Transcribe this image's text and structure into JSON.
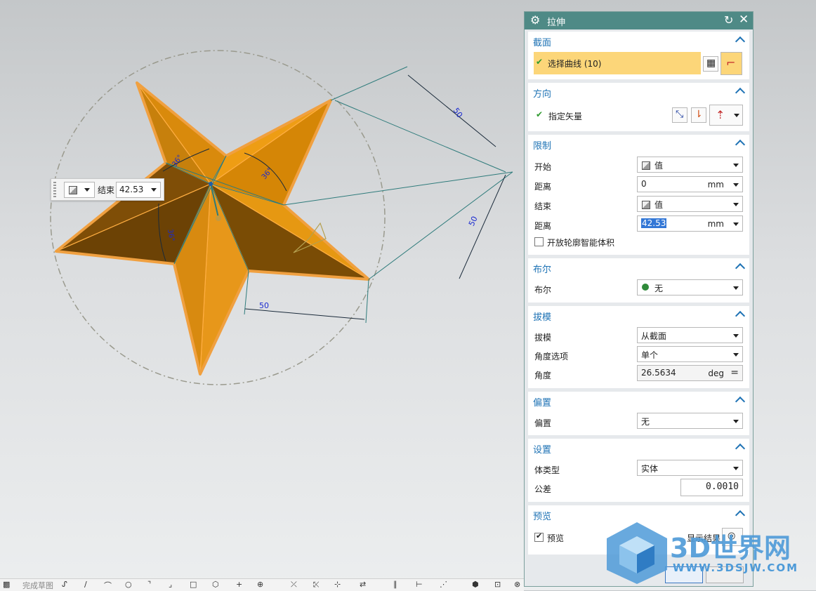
{
  "dialog": {
    "title": "拉伸",
    "sections": {
      "section": {
        "header": "截面",
        "select_curve": "选择曲线 (10)"
      },
      "direction": {
        "header": "方向",
        "vector": "指定矢量"
      },
      "limits": {
        "header": "限制",
        "start_label": "开始",
        "start_value": "值",
        "start_dist_label": "距离",
        "start_dist_value": "0",
        "start_dist_unit": "mm",
        "end_label": "结束",
        "end_value": "值",
        "end_dist_label": "距离",
        "end_dist_value": "42.53",
        "end_dist_unit": "mm",
        "open_profile": "开放轮廓智能体积"
      },
      "boolean": {
        "header": "布尔",
        "label": "布尔",
        "value": "无"
      },
      "draft": {
        "header": "拔模",
        "draft_label": "拔模",
        "draft_value": "从截面",
        "angle_option_label": "角度选项",
        "angle_option_value": "单个",
        "angle_label": "角度",
        "angle_value": "26.5634",
        "angle_unit": "deg"
      },
      "offset": {
        "header": "偏置",
        "label": "偏置",
        "value": "无"
      },
      "settings": {
        "header": "设置",
        "body_type_label": "体类型",
        "body_type_value": "实体",
        "tolerance_label": "公差",
        "tolerance_value": "0.0010"
      },
      "preview": {
        "header": "预览",
        "checkbox": "预览",
        "show_result": "显示结果"
      }
    }
  },
  "viewport": {
    "floating": {
      "label": "结束",
      "value": "42.53"
    },
    "dimensions": {
      "d1": "50",
      "d2": "50",
      "d3": "50",
      "a1": "36°",
      "a2": "36°",
      "a3": "36°"
    }
  },
  "toolbar": {
    "finish_sketch": "完成草图"
  },
  "watermark": {
    "brand": "3D世界网",
    "url": "WWW.3DSJW.COM"
  },
  "colors": {
    "title_bar": "#4f8a86",
    "section_header": "#1f73b5",
    "highlight": "#fcd679",
    "star_light": "#f5a623",
    "star_dark": "#7a4c05"
  }
}
